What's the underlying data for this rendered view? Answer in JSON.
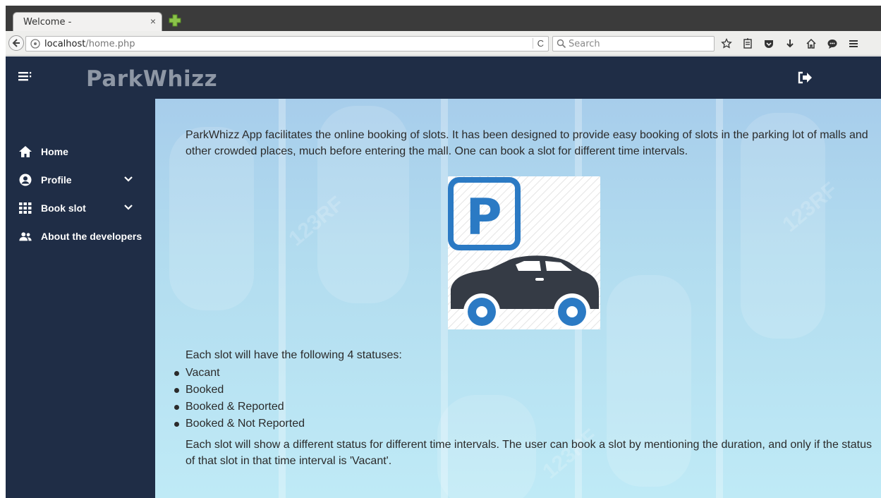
{
  "browser": {
    "tab_title": "Welcome -",
    "tab_close": "×",
    "url_host": "localhost",
    "url_path": "/home.php",
    "reload": "C",
    "search_placeholder": "Search"
  },
  "header": {
    "brand": "ParkWhizz"
  },
  "sidebar": {
    "items": [
      {
        "label": "Home",
        "icon": "home-icon"
      },
      {
        "label": "Profile",
        "icon": "user-circle-icon",
        "expandable": true
      },
      {
        "label": "Book slot",
        "icon": "grid-icon",
        "expandable": true
      },
      {
        "label": "About the developers",
        "icon": "users-icon"
      }
    ]
  },
  "main": {
    "intro": "ParkWhizz App facilitates the online booking of slots. It has been designed to provide easy booking of slots in the parking lot of malls and other crowded places, much before entering the mall. One can book a slot for different time intervals.",
    "statuses_title": "Each slot will have the following 4 statuses:",
    "statuses": [
      "Vacant",
      "Booked",
      "Booked & Reported",
      "Booked & Not Reported"
    ],
    "closing": "Each slot will show a different status for different time intervals. The user can book a slot by mentioning the duration, and only if the status of that slot in that time interval is 'Vacant'.",
    "logo_letter": "P"
  },
  "colors": {
    "header_bg": "#1f2d46",
    "brand_text": "#8e97a5",
    "logo_blue": "#2b7ac4",
    "car_dark": "#353b45"
  }
}
